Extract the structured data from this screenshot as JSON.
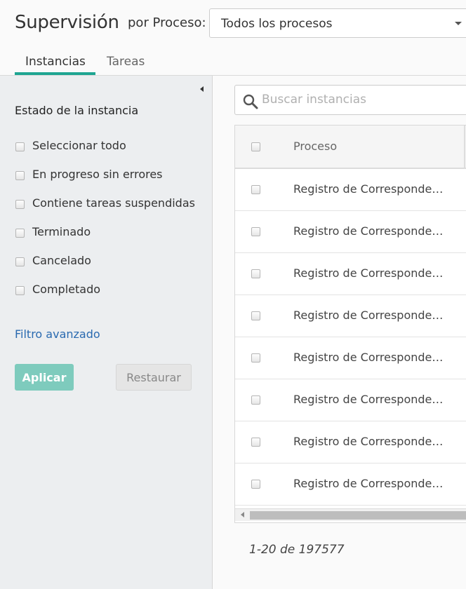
{
  "header": {
    "title": "Supervisión",
    "process_label": "por Proceso:",
    "process_select_value": "Todos los procesos",
    "tabs": [
      {
        "label": "Instancias",
        "active": true
      },
      {
        "label": "Tareas",
        "active": false
      }
    ]
  },
  "sidebar": {
    "heading": "Estado de la instancia",
    "filters": [
      {
        "label": "Seleccionar todo",
        "checked": false
      },
      {
        "label": "En progreso sin errores",
        "checked": false
      },
      {
        "label": "Contiene tareas suspendidas",
        "checked": false
      },
      {
        "label": "Terminado",
        "checked": false
      },
      {
        "label": "Cancelado",
        "checked": false
      },
      {
        "label": "Completado",
        "checked": false
      }
    ],
    "advanced_filter_link": "Filtro avanzado",
    "apply_button": "Aplicar",
    "reset_button": "Restaurar",
    "collapse_icon": "triangle-left-icon"
  },
  "search": {
    "placeholder": "Buscar instancias",
    "value": "",
    "icon": "search-icon"
  },
  "table": {
    "columns": [
      {
        "label": "Proceso"
      }
    ],
    "rows": [
      {
        "proceso": "Registro de Correspondencia"
      },
      {
        "proceso": "Registro de Correspondencia"
      },
      {
        "proceso": "Registro de Correspondencia"
      },
      {
        "proceso": "Registro de Correspondencia"
      },
      {
        "proceso": "Registro de Correspondencia"
      },
      {
        "proceso": "Registro de Correspondencia"
      },
      {
        "proceso": "Registro de Correspondencia"
      },
      {
        "proceso": "Registro de Correspondencia"
      }
    ]
  },
  "pagination": {
    "range_text": "1-20 de 197577"
  },
  "colors": {
    "accent": "#1fa592",
    "apply_button": "#7ecbbd",
    "link": "#2a6ab0",
    "sidebar_bg": "#eceef0"
  }
}
